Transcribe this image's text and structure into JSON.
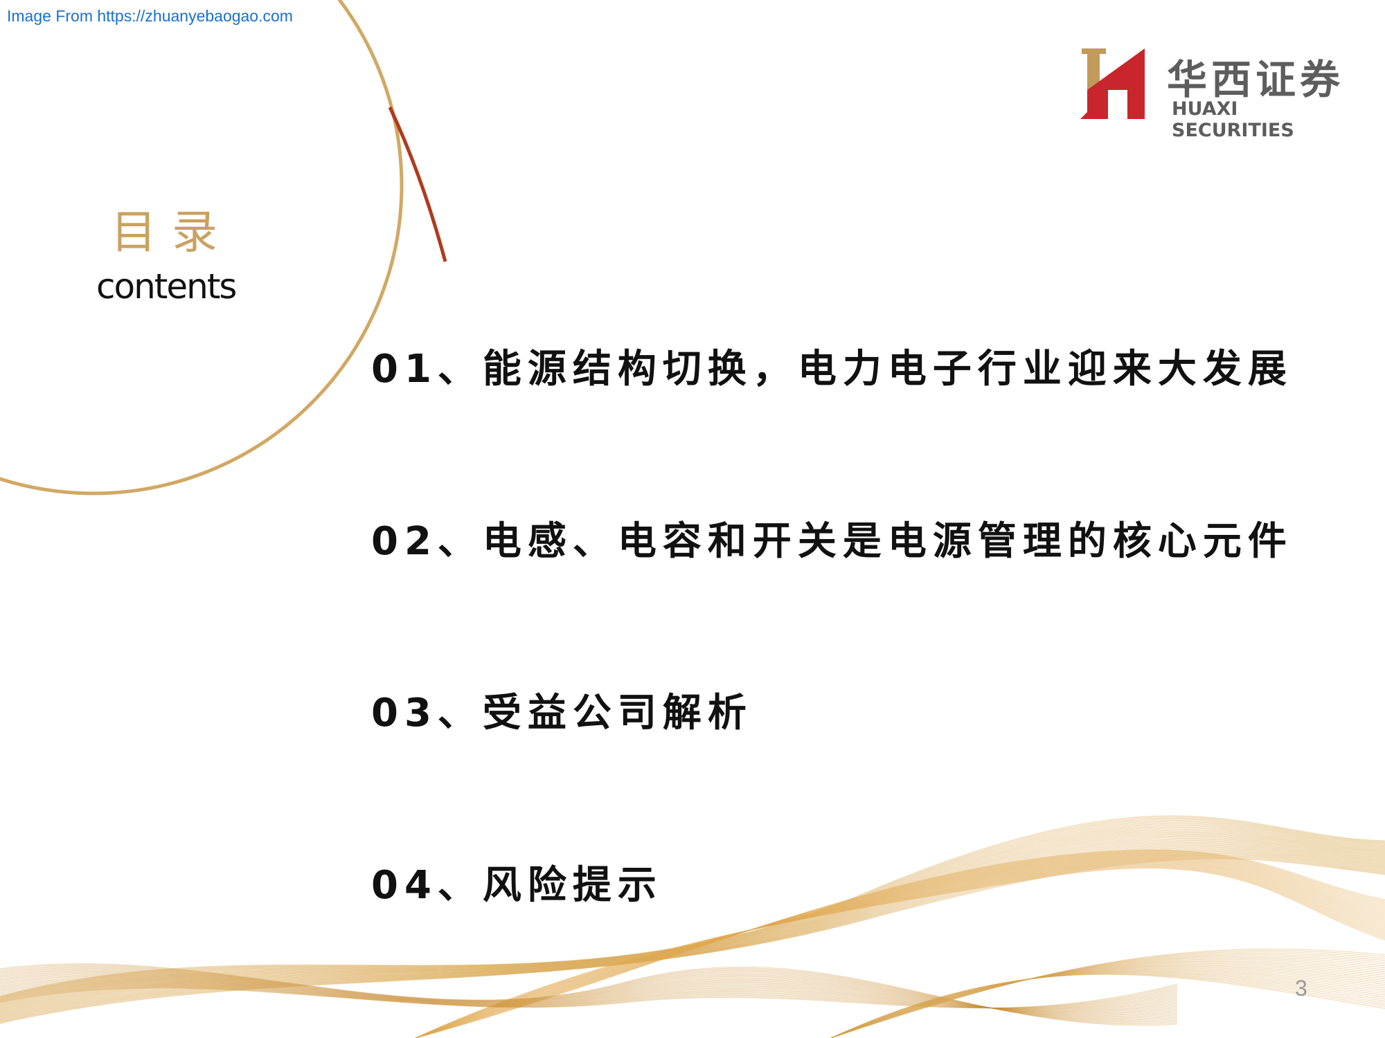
{
  "source_note": "Image From https://zhuanyebaogao.com",
  "brand": {
    "name_cn": "华西证券",
    "name_en": "HUAXI SECURITIES",
    "colors": {
      "gold": "#c9a260",
      "red": "#c8262c",
      "arc_red": "#b03a1e"
    }
  },
  "toc": {
    "title_cn": "目录",
    "title_en": "contents",
    "items": [
      {
        "label": "01、能源结构切换，电力电子行业迎来大发展"
      },
      {
        "label": "02、电感、电容和开关是电源管理的核心元件"
      },
      {
        "label": "03、受益公司解析"
      },
      {
        "label": "04、风险提示"
      }
    ]
  },
  "page_number": "3"
}
